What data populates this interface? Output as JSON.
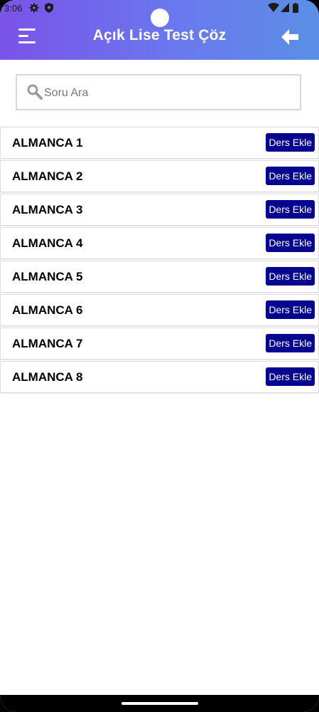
{
  "status_bar": {
    "time": "3:06",
    "icons": [
      "gear-icon",
      "shield-icon",
      "wifi-icon",
      "signal-icon",
      "battery-icon"
    ]
  },
  "header": {
    "title": "Açık Lise Test Çöz",
    "menu_icon": "menu-icon",
    "back_icon": "back-arrow-icon"
  },
  "search": {
    "placeholder": "Soru Ara",
    "value": ""
  },
  "list": {
    "items": [
      {
        "label": "ALMANCA 1",
        "button": "Ders Ekle"
      },
      {
        "label": "ALMANCA 2",
        "button": "Ders Ekle"
      },
      {
        "label": "ALMANCA 3",
        "button": "Ders Ekle"
      },
      {
        "label": "ALMANCA 4",
        "button": "Ders Ekle"
      },
      {
        "label": "ALMANCA 5",
        "button": "Ders Ekle"
      },
      {
        "label": "ALMANCA 6",
        "button": "Ders Ekle"
      },
      {
        "label": "ALMANCA 7",
        "button": "Ders Ekle"
      },
      {
        "label": "ALMANCA 8",
        "button": "Ders Ekle"
      }
    ]
  },
  "colors": {
    "header_start": "#7a53e8",
    "header_end": "#5b8fe6",
    "button": "#05058f"
  }
}
